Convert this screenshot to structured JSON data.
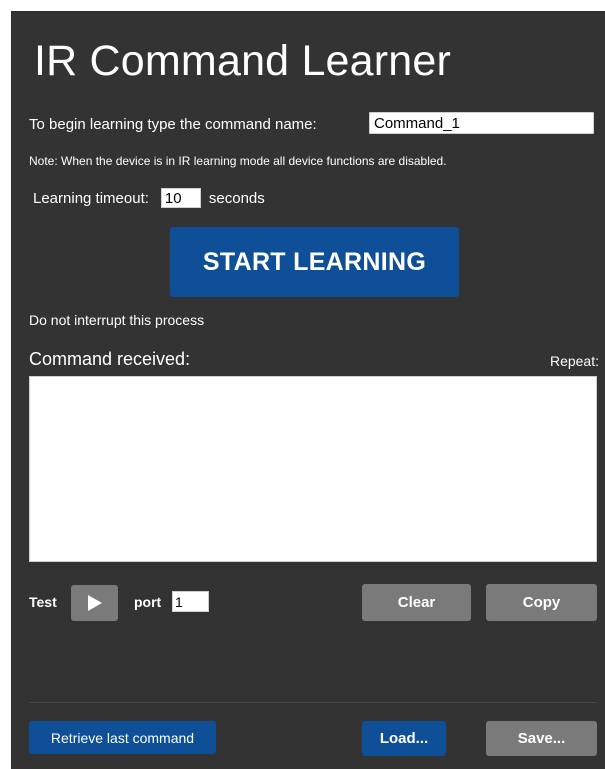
{
  "title": "IR Command Learner",
  "learn": {
    "prompt": "To begin learning type the command name:",
    "command_name": "Command_1",
    "note": "Note: When the device is in IR learning mode all device functions are disabled.",
    "timeout_label": "Learning timeout:",
    "timeout_value": "10",
    "timeout_unit": "seconds",
    "start_label": "START LEARNING",
    "interrupt_warning": "Do not interrupt this process"
  },
  "received": {
    "label": "Command received:",
    "repeat_label": "Repeat:",
    "value": ""
  },
  "test": {
    "label": "Test",
    "play_icon": "play-icon",
    "port_label": "port",
    "port_value": "1",
    "clear_label": "Clear",
    "copy_label": "Copy"
  },
  "footer": {
    "retrieve_label": "Retrieve last command",
    "load_label": "Load...",
    "save_label": "Save..."
  },
  "colors": {
    "panel_bg": "#333333",
    "primary_blue": "#0e4f97",
    "gray_button": "#7a7a7a"
  }
}
